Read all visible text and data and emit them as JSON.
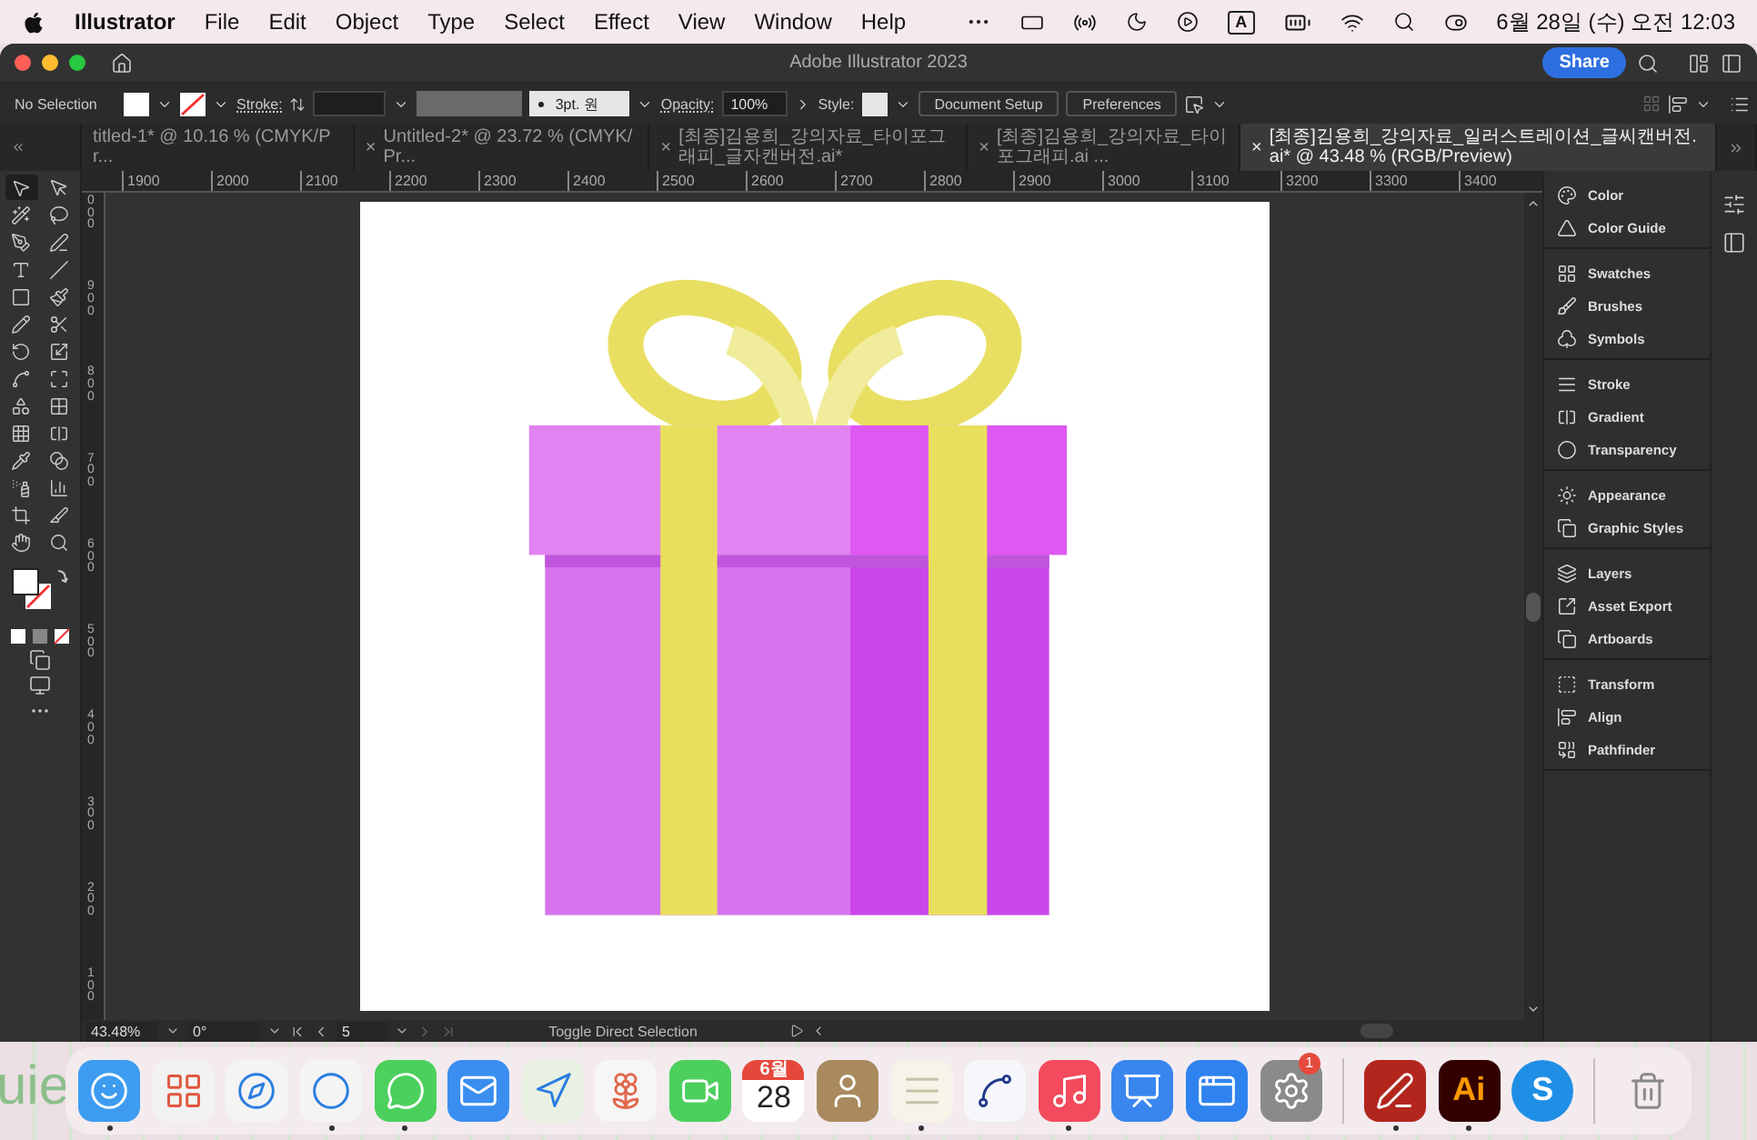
{
  "menubar": {
    "app_name": "Illustrator",
    "menus": [
      "File",
      "Edit",
      "Object",
      "Type",
      "Select",
      "Effect",
      "View",
      "Window",
      "Help"
    ],
    "input_source": "A",
    "clock": "6월 28일 (수) 오전 12:03"
  },
  "window": {
    "title": "Adobe Illustrator 2023",
    "share": "Share"
  },
  "control_bar": {
    "selection": "No Selection",
    "stroke_label": "Stroke:",
    "brush": "3pt. 원",
    "opacity_label": "Opacity:",
    "opacity": "100%",
    "style_label": "Style:",
    "buttons": [
      "Document Setup",
      "Preferences"
    ]
  },
  "tabs": [
    {
      "label": "titled-1* @ 10.16 % (CMYK/Pr...",
      "selected": false
    },
    {
      "label": "Untitled-2* @ 23.72 % (CMYK/Pr...",
      "close": "×",
      "selected": false
    },
    {
      "label": "[최종]김용희_강의자료_타이포그래피_글자캔버전.ai*",
      "close": "×",
      "selected": false
    },
    {
      "label": "[최종]김용희_강의자료_타이포그래피.ai ...",
      "close": "×",
      "selected": false
    },
    {
      "label": "[최종]김용희_강의자료_일러스트레이션_글씨캔버전.ai* @ 43.48 % (RGB/Preview)",
      "close": "×",
      "selected": true
    }
  ],
  "tools": [
    {
      "selected": true
    },
    {
      "selected": false
    },
    {
      "selected": false
    },
    {
      "selected": false
    },
    {
      "selected": false
    },
    {
      "selected": false
    },
    {
      "selected": false
    },
    {
      "selected": false
    },
    {
      "selected": false
    },
    {
      "selected": false
    },
    {
      "selected": false
    },
    {
      "selected": false
    },
    {
      "selected": false
    },
    {
      "selected": false
    },
    {
      "selected": false
    },
    {
      "selected": false
    },
    {
      "selected": false
    },
    {
      "selected": false
    },
    {
      "selected": false
    },
    {
      "selected": false
    },
    {
      "selected": false
    },
    {
      "selected": false
    },
    {
      "selected": false
    },
    {
      "selected": false
    },
    {
      "selected": false
    },
    {
      "selected": false
    },
    {
      "selected": false
    },
    {
      "selected": false
    }
  ],
  "ruler": {
    "horizontal": [
      "1900",
      "2000",
      "2100",
      "2200",
      "2300",
      "2400",
      "2500",
      "2600",
      "2700",
      "2800",
      "2900",
      "3000",
      "3100",
      "3200",
      "3300",
      "3400"
    ],
    "vertical": [
      "000",
      "900",
      "800",
      "700",
      "600",
      "500",
      "400",
      "300",
      "200",
      "100"
    ]
  },
  "panels": [
    {
      "items": [
        {
          "label": "Color"
        },
        {
          "label": "Color Guide"
        }
      ]
    },
    {
      "items": [
        {
          "label": "Swatches"
        },
        {
          "label": "Brushes"
        },
        {
          "label": "Symbols"
        }
      ]
    },
    {
      "items": [
        {
          "label": "Stroke"
        },
        {
          "label": "Gradient"
        },
        {
          "label": "Transparency"
        }
      ]
    },
    {
      "items": [
        {
          "label": "Appearance"
        },
        {
          "label": "Graphic Styles"
        }
      ]
    },
    {
      "items": [
        {
          "label": "Layers"
        },
        {
          "label": "Asset Export"
        },
        {
          "label": "Artboards"
        }
      ]
    },
    {
      "items": [
        {
          "label": "Transform"
        },
        {
          "label": "Align"
        },
        {
          "label": "Pathfinder"
        }
      ]
    }
  ],
  "status_bar": {
    "zoom": "43.48%",
    "rotation": "0°",
    "artboard": "5",
    "hint": "Toggle Direct Selection"
  },
  "desktop_text": "uie",
  "dock": [
    {
      "kind": "face",
      "running": true
    },
    {
      "kind": "grid",
      "running": false
    },
    {
      "kind": "compass",
      "running": false
    },
    {
      "kind": "ring",
      "running": true
    },
    {
      "kind": "chat",
      "running": true
    },
    {
      "kind": "mail",
      "running": false
    },
    {
      "kind": "map",
      "running": false
    },
    {
      "kind": "flower",
      "running": false
    },
    {
      "kind": "camera",
      "running": false
    },
    {
      "kind": "calendar",
      "running": false,
      "month": "6월",
      "day": "28"
    },
    {
      "kind": "contact",
      "running": false
    },
    {
      "kind": "notes",
      "running": true
    },
    {
      "kind": "scribble",
      "running": false
    },
    {
      "kind": "music",
      "running": true
    },
    {
      "kind": "podium",
      "running": false
    },
    {
      "kind": "store",
      "running": false
    },
    {
      "kind": "gear",
      "running": false,
      "badge": "1"
    },
    {
      "kind": "separator"
    },
    {
      "kind": "pdf",
      "running": true
    },
    {
      "kind": "logo",
      "running": true,
      "label": "Ai",
      "color": "#330000"
    },
    {
      "kind": "logo",
      "running": false,
      "label": "S",
      "color": "#1f8fe6"
    },
    {
      "kind": "separator"
    },
    {
      "kind": "trash",
      "running": false
    }
  ]
}
